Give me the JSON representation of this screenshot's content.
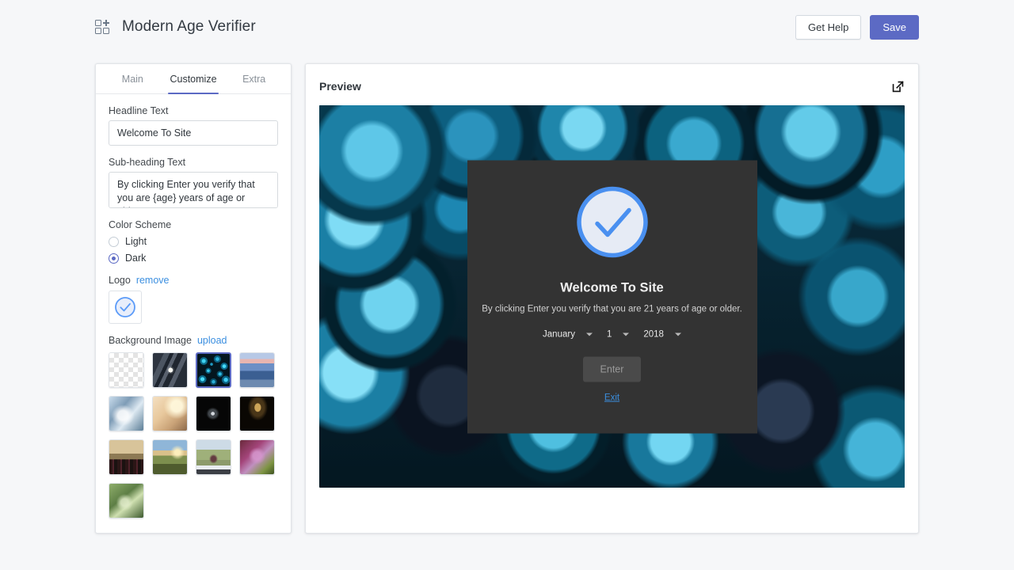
{
  "header": {
    "logo_icon": "grid-plus-icon",
    "title": "Modern Age Verifier",
    "get_help_label": "Get Help",
    "save_label": "Save"
  },
  "colors": {
    "accent": "#5c6ac4",
    "link": "#3b8fe0",
    "page_bg": "#f6f7f9",
    "modal_bg": "#333333",
    "check_blue": "#5b9bf8"
  },
  "settings": {
    "tabs": [
      {
        "label": "Main",
        "active": false
      },
      {
        "label": "Customize",
        "active": true
      },
      {
        "label": "Extra",
        "active": false
      }
    ],
    "headline": {
      "label": "Headline Text",
      "value": "Welcome To Site",
      "placeholder": "Headline Text"
    },
    "subheading": {
      "label": "Sub-heading Text",
      "value": "By clicking Enter you verify that you are {age} years of age or older.",
      "placeholder": "Sub-heading Text"
    },
    "color_scheme": {
      "label": "Color Scheme",
      "options": [
        {
          "label": "Light",
          "selected": false
        },
        {
          "label": "Dark",
          "selected": true
        }
      ]
    },
    "logo": {
      "label": "Logo",
      "remove_label": "remove",
      "icon": "check-circle-icon"
    },
    "background_image": {
      "label": "Background Image",
      "upload_label": "upload",
      "thumbnails": [
        {
          "name": "none-transparent",
          "selected": false
        },
        {
          "name": "corridor",
          "selected": false
        },
        {
          "name": "blue-marbles",
          "selected": true
        },
        {
          "name": "blue-field-dusk",
          "selected": false
        },
        {
          "name": "smoke-blue",
          "selected": false
        },
        {
          "name": "hand-sunlight",
          "selected": false
        },
        {
          "name": "smoke-dark",
          "selected": false
        },
        {
          "name": "smoke-gold",
          "selected": false
        },
        {
          "name": "wine-bottles",
          "selected": false
        },
        {
          "name": "vineyard-sunset",
          "selected": false
        },
        {
          "name": "wine-glass-vineyard",
          "selected": false
        },
        {
          "name": "flower-purple",
          "selected": false
        },
        {
          "name": "green-plant",
          "selected": false
        }
      ]
    }
  },
  "preview": {
    "title": "Preview",
    "expand_icon": "external-link-icon",
    "background": "blue-marbles",
    "modal": {
      "logo_icon": "check-circle-icon",
      "headline": "Welcome To Site",
      "subheading": "By clicking Enter you verify that you are 21 years of age or older.",
      "date": {
        "month": "January",
        "day": "1",
        "year": "2018"
      },
      "enter_label": "Enter",
      "exit_label": "Exit"
    }
  }
}
